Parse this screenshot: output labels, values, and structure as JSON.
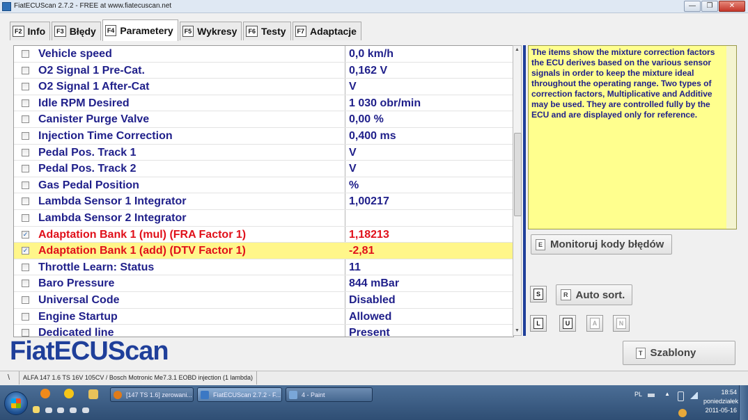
{
  "window": {
    "title": "FiatECUScan 2.7.2 - FREE at www.fiatecuscan.net",
    "buttons": [
      "—",
      "❐",
      "✕"
    ]
  },
  "tabs": [
    {
      "key": "F2",
      "label": "Info",
      "active": false
    },
    {
      "key": "F3",
      "label": "Błędy",
      "active": false
    },
    {
      "key": "F4",
      "label": "Parametery",
      "active": true
    },
    {
      "key": "F5",
      "label": "Wykresy",
      "active": false
    },
    {
      "key": "F6",
      "label": "Testy",
      "active": false
    },
    {
      "key": "F7",
      "label": "Adaptacje",
      "active": false
    }
  ],
  "parameters": [
    {
      "name": "Vehicle speed",
      "value": "0,0 km/h",
      "checked": false,
      "highlight": false,
      "alert": false
    },
    {
      "name": "O2 Signal 1 Pre-Cat.",
      "value": "0,162 V",
      "checked": false,
      "highlight": false,
      "alert": false
    },
    {
      "name": "O2 Signal 1 After-Cat",
      "value": " V",
      "checked": false,
      "highlight": false,
      "alert": false
    },
    {
      "name": "Idle RPM Desired",
      "value": "1 030 obr/min",
      "checked": false,
      "highlight": false,
      "alert": false
    },
    {
      "name": "Canister Purge Valve",
      "value": "0,00 %",
      "checked": false,
      "highlight": false,
      "alert": false
    },
    {
      "name": "Injection Time Correction",
      "value": "0,400 ms",
      "checked": false,
      "highlight": false,
      "alert": false
    },
    {
      "name": "Pedal Pos. Track 1",
      "value": " V",
      "checked": false,
      "highlight": false,
      "alert": false
    },
    {
      "name": "Pedal Pos. Track 2",
      "value": " V",
      "checked": false,
      "highlight": false,
      "alert": false
    },
    {
      "name": "Gas Pedal Position",
      "value": " %",
      "checked": false,
      "highlight": false,
      "alert": false
    },
    {
      "name": "Lambda Sensor 1 Integrator",
      "value": "1,00217",
      "checked": false,
      "highlight": false,
      "alert": false
    },
    {
      "name": "Lambda Sensor 2 Integrator",
      "value": "",
      "checked": false,
      "highlight": false,
      "alert": false
    },
    {
      "name": "Adaptation Bank 1 (mul) (FRA Factor 1)",
      "value": "1,18213",
      "checked": true,
      "highlight": false,
      "alert": true
    },
    {
      "name": "Adaptation Bank 1 (add) (DTV Factor 1)",
      "value": "-2,81",
      "checked": true,
      "highlight": true,
      "alert": true
    },
    {
      "name": "Throttle Learn: Status",
      "value": "11",
      "checked": false,
      "highlight": false,
      "alert": false
    },
    {
      "name": "Baro Pressure",
      "value": "844 mBar",
      "checked": false,
      "highlight": false,
      "alert": false
    },
    {
      "name": "Universal Code",
      "value": "Disabled",
      "checked": false,
      "highlight": false,
      "alert": false
    },
    {
      "name": "Engine Startup",
      "value": "Allowed",
      "checked": false,
      "highlight": false,
      "alert": false
    },
    {
      "name": "Dedicated line",
      "value": "Present",
      "checked": false,
      "highlight": false,
      "alert": false
    }
  ],
  "info": {
    "text": "The items show the mixture correction factors the ECU derives based on the various sensor signals in order to keep the mixture ideal throughout the operating range. Two types of correction factors, Multiplicative and Additive may be used. They are controlled fully by the ECU and are displayed only for reference."
  },
  "buttons": {
    "monitor": {
      "key": "E",
      "label": "Monitoruj kody błędów"
    },
    "s_key": "S",
    "autosort": {
      "key": "R",
      "label": "Auto sort."
    },
    "l_key": "L",
    "u_key": "U",
    "a_key": "A",
    "n_key": "N",
    "templates": {
      "key": "T",
      "label": "Szablony"
    }
  },
  "logo": "FiatECUScan",
  "statusbar": {
    "grip": "\\",
    "vehicle": "ALFA 147 1.6 TS 16V 105CV / Bosch Motronic Me7.3.1 EOBD injection (1 lambda)"
  },
  "taskbar": {
    "windows": [
      {
        "label": "[147 TS 1.6] zerowani...",
        "icon_color": "#e07b1a"
      },
      {
        "label": "FiatECUScan 2.7.2 - F...",
        "icon_color": "#3b78c4"
      },
      {
        "label": "4 - Paint",
        "icon_color": "#7aa7d8"
      }
    ],
    "lang": "PL",
    "time": "18:54",
    "day": "poniedziałek",
    "date": "2011-05-16"
  },
  "colors": {
    "param_text": "#1f1f8a",
    "alert_text": "#e0101a",
    "highlight_row": "#fff68a",
    "info_bg": "#ffff8e",
    "divider": "#1f3f9a"
  }
}
